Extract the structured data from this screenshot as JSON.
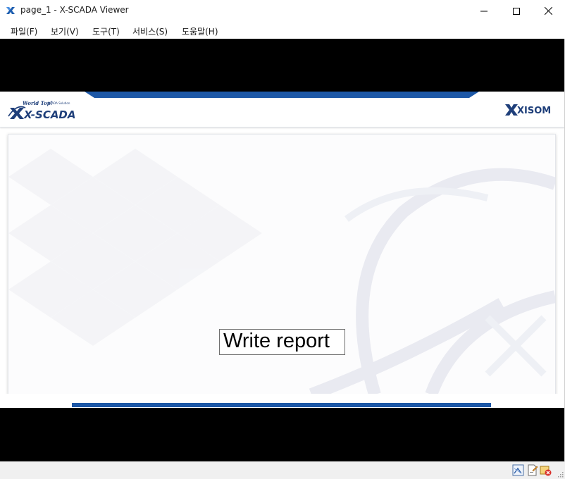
{
  "window": {
    "title": "page_1 - X-SCADA Viewer",
    "icon": "x-scada-app-icon",
    "controls": [
      "minimize-icon",
      "maximize-icon",
      "close-icon"
    ]
  },
  "menu": {
    "items": [
      {
        "label": "파일(F)"
      },
      {
        "label": "보기(V)"
      },
      {
        "label": "도구(T)"
      },
      {
        "label": "서비스(S)"
      },
      {
        "label": "도움말(H)"
      }
    ]
  },
  "header": {
    "logo_left": {
      "tagline": "World Top!",
      "subtitle": "SCADA Solution",
      "name": "X-SCADA"
    },
    "logo_right": {
      "name": "XISOM"
    }
  },
  "main": {
    "report_button": {
      "label": "Write report"
    }
  },
  "status": {
    "icons": [
      "network-icon",
      "document-edit-icon",
      "alarm-error-icon"
    ]
  },
  "colors": {
    "brand_blue": "#1d58a7",
    "brand_navy": "#1f3f7a",
    "panel_bg": "#fcfcfd",
    "black_band": "#000000"
  }
}
